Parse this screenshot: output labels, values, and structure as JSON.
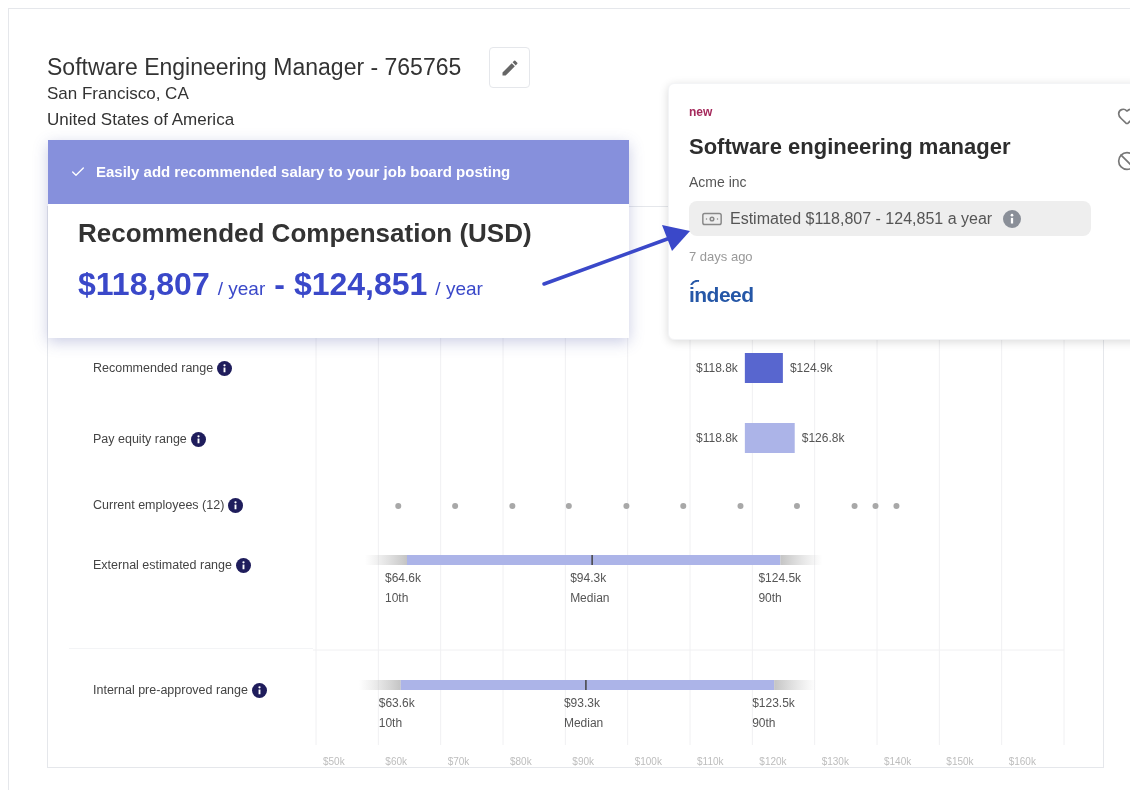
{
  "job": {
    "title": "Software Engineering Manager - 765765",
    "city": "San Francisco, CA",
    "country": "United States of America"
  },
  "recommendation": {
    "banner": "Easily add recommended salary to your job board posting",
    "heading": "Recommended Compensation (USD)",
    "low": "$118,807",
    "low_unit": "/ year",
    "separator": "-",
    "high": "$124,851",
    "high_unit": "/ year"
  },
  "job_post": {
    "badge": "new",
    "title": "Software engineering manager",
    "company": "Acme inc",
    "salary": "Estimated $118,807 - 124,851 a year",
    "posted": "7 days ago",
    "source": "indeed"
  },
  "salary_chart": {
    "rows": [
      {
        "label": "Recommended range",
        "kind": "range",
        "color": "#5866cf",
        "low": "$118.8k",
        "high": "$124.9k"
      },
      {
        "label": "Pay equity range",
        "kind": "range",
        "color": "#acb4e8",
        "low": "$118.8k",
        "high": "$126.8k"
      },
      {
        "label": "Current employees (12)",
        "kind": "dots"
      },
      {
        "label": "External estimated range",
        "kind": "percentiles",
        "color": "#acb4e8",
        "marks": [
          {
            "value": "$64.6k",
            "label": "10th"
          },
          {
            "value": "$94.3k",
            "label": "Median"
          },
          {
            "value": "$124.5k",
            "label": "90th"
          }
        ]
      },
      {
        "label": "Internal pre-approved range",
        "kind": "percentiles",
        "color": "#acb4e8",
        "marks": [
          {
            "value": "$63.6k",
            "label": "10th"
          },
          {
            "value": "$93.3k",
            "label": "Median"
          },
          {
            "value": "$123.5k",
            "label": "90th"
          }
        ]
      }
    ],
    "axis_labels": [
      "$50k",
      "$60k",
      "$70k",
      "$80k",
      "$90k",
      "$100k",
      "$110k",
      "$120k",
      "$130k",
      "$140k",
      "$150k",
      "$160k"
    ]
  }
}
